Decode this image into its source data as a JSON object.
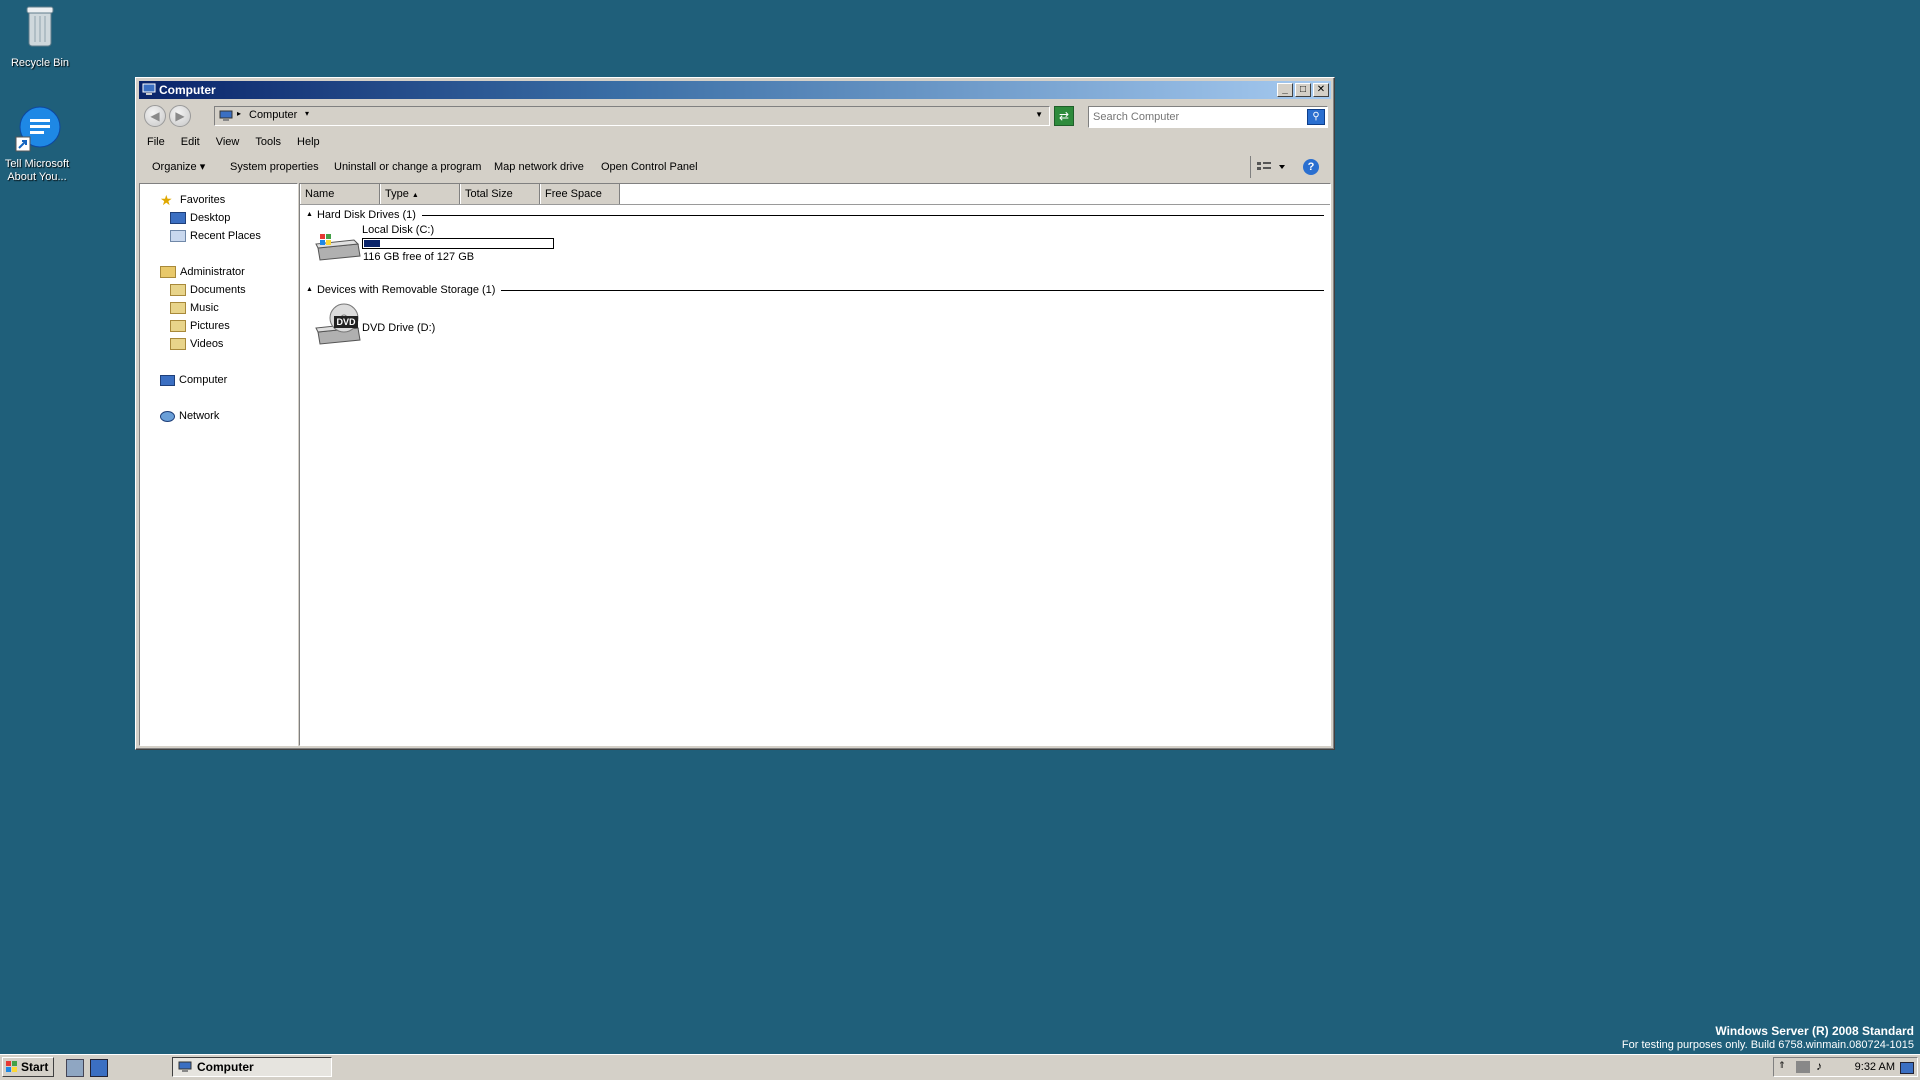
{
  "desktop": {
    "icons": [
      {
        "label": "Recycle Bin",
        "icon": "recycle-bin-icon"
      },
      {
        "label": "Tell Microsoft About You...",
        "icon": "feedback-icon"
      }
    ],
    "watermark": {
      "line1": "Windows Server (R) 2008 Standard",
      "line2": "For testing purposes only. Build 6758.winmain.080724-1015"
    }
  },
  "window": {
    "title": "Computer",
    "controls": {
      "minimize": "_",
      "maximize": "□",
      "close": "✕"
    },
    "address": {
      "location": "Computer"
    },
    "search": {
      "placeholder": "Search Computer"
    },
    "menu": [
      "File",
      "Edit",
      "View",
      "Tools",
      "Help"
    ],
    "commands": [
      "Organize",
      "System properties",
      "Uninstall or change a program",
      "Map network drive",
      "Open Control Panel"
    ],
    "help_label": "?",
    "nav": {
      "favorites": {
        "label": "Favorites",
        "items": [
          "Desktop",
          "Recent Places"
        ]
      },
      "user": {
        "label": "Administrator",
        "items": [
          "Documents",
          "Music",
          "Pictures",
          "Videos"
        ]
      },
      "computer": "Computer",
      "network": "Network"
    },
    "columns": [
      "Name",
      "Type",
      "Total Size",
      "Free Space"
    ],
    "groups": [
      {
        "title": "Hard Disk Drives (1)",
        "items": [
          {
            "name": "Local Disk (C:)",
            "usage_fraction": 0.087,
            "free_text": "116 GB free of 127 GB"
          }
        ]
      },
      {
        "title": "Devices with Removable Storage (1)",
        "items": [
          {
            "name": "DVD Drive (D:)",
            "icon_text": "DVD"
          }
        ]
      }
    ]
  },
  "taskbar": {
    "start_label": "Start",
    "task_label": "Computer",
    "clock": "9:32 AM"
  },
  "colors": {
    "desktop": "#1f5f7a",
    "titlebar_start": "#0a246a",
    "progress_fill": "#0a246a"
  }
}
